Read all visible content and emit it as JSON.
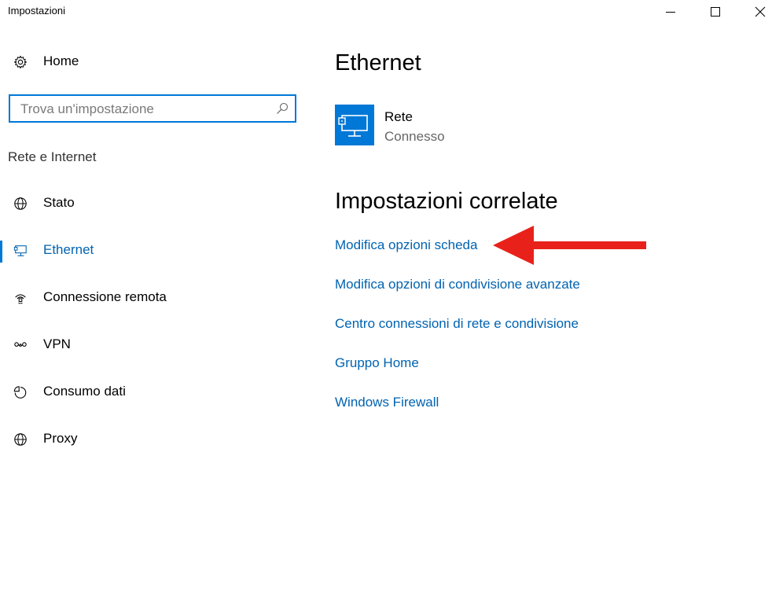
{
  "window": {
    "title": "Impostazioni"
  },
  "sidebar": {
    "home_label": "Home",
    "search_placeholder": "Trova un'impostazione",
    "section_heading": "Rete e Internet",
    "items": [
      {
        "label": "Stato",
        "icon": "globe-icon",
        "active": false
      },
      {
        "label": "Ethernet",
        "icon": "ethernet-icon",
        "active": true
      },
      {
        "label": "Connessione remota",
        "icon": "dialup-icon",
        "active": false
      },
      {
        "label": "VPN",
        "icon": "vpn-icon",
        "active": false
      },
      {
        "label": "Consumo dati",
        "icon": "data-usage-icon",
        "active": false
      },
      {
        "label": "Proxy",
        "icon": "globe-icon",
        "active": false
      }
    ]
  },
  "main": {
    "title": "Ethernet",
    "network": {
      "name": "Rete",
      "status": "Connesso",
      "icon": "ethernet-monitor-icon"
    },
    "related_title": "Impostazioni correlate",
    "related_links": [
      "Modifica opzioni scheda",
      "Modifica opzioni di condivisione avanzate",
      "Centro connessioni di rete e condivisione",
      "Gruppo Home",
      "Windows Firewall"
    ]
  },
  "colors": {
    "accent": "#0078d7",
    "link": "#0063b1",
    "annotation_arrow": "#e8221b"
  }
}
